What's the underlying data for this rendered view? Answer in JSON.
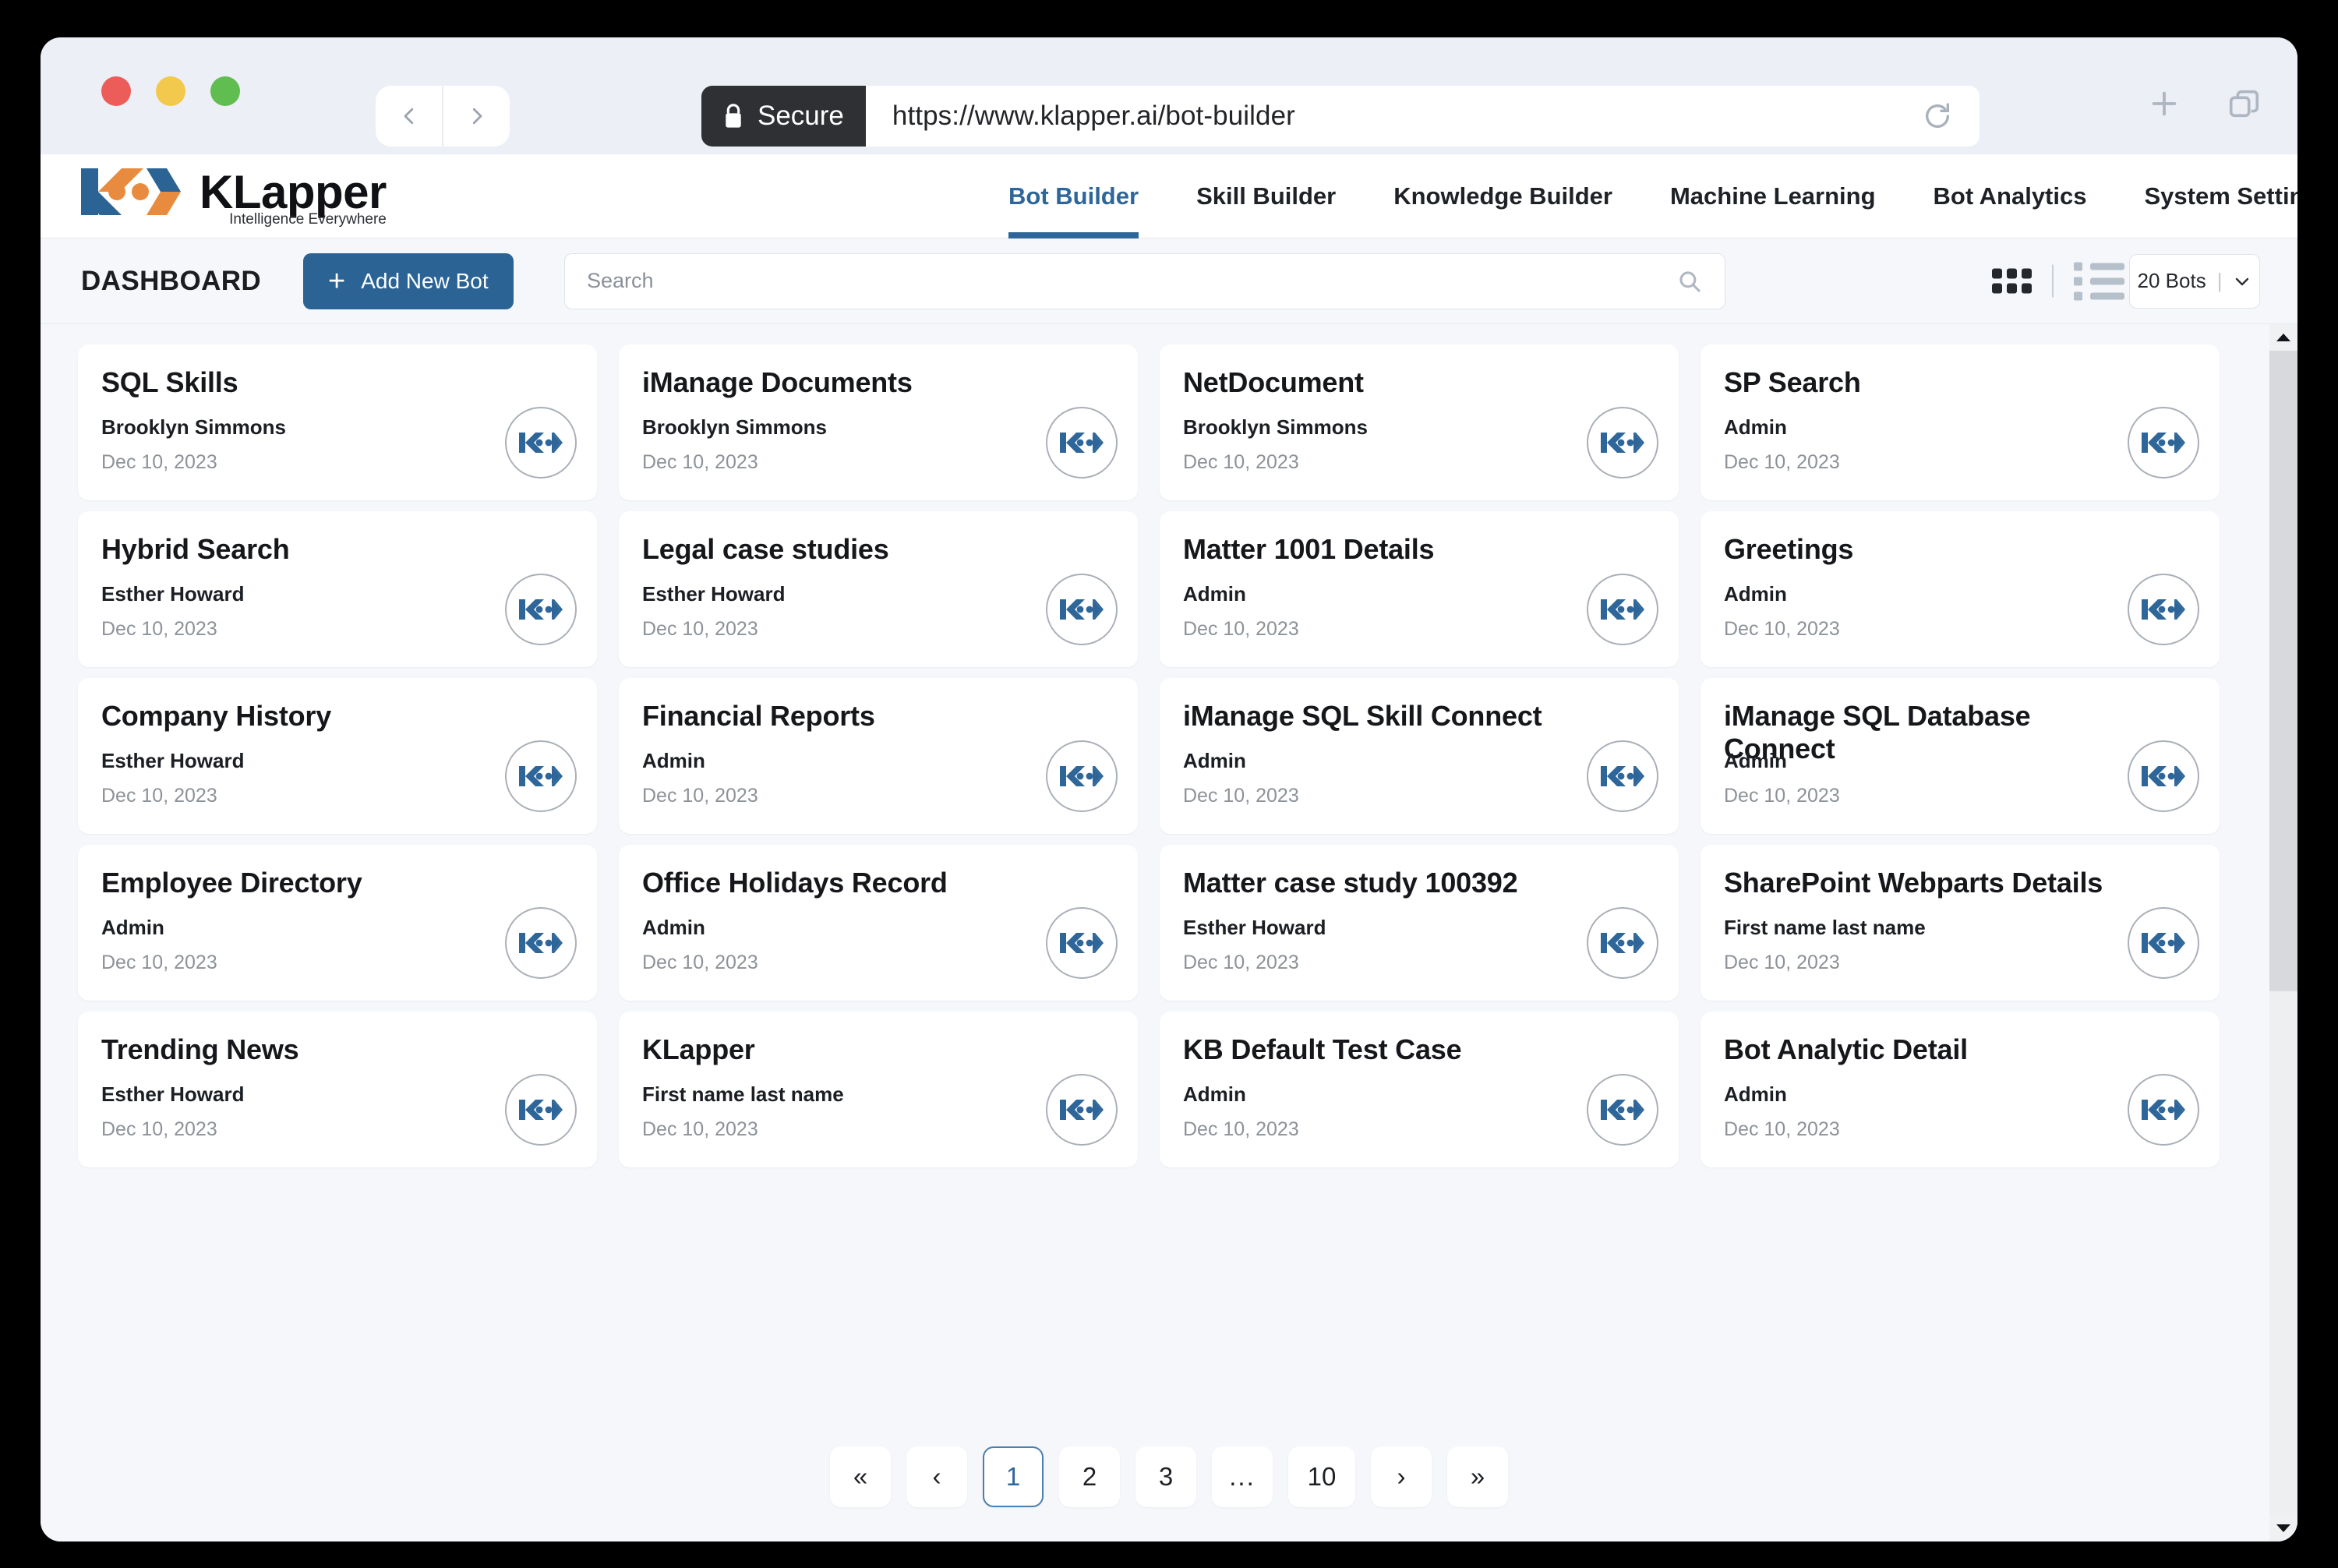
{
  "browser": {
    "back_icon": "chevron-left-icon",
    "forward_icon": "chevron-right-icon",
    "secure_label": "Secure",
    "url": "https://www.klapper.ai/bot-builder",
    "reload_icon": "reload-icon",
    "new_tab_icon": "plus-icon",
    "tabs_icon": "copy-tabs-icon"
  },
  "header": {
    "logo_word": "KLapper",
    "logo_tagline": "Intelligence Everywhere",
    "nav": [
      {
        "label": "Bot Builder",
        "active": true
      },
      {
        "label": "Skill Builder",
        "active": false
      },
      {
        "label": "Knowledge Builder",
        "active": false
      },
      {
        "label": "Machine Learning",
        "active": false
      },
      {
        "label": "Bot Analytics",
        "active": false
      },
      {
        "label": "System Settings",
        "active": false
      }
    ]
  },
  "toolbar": {
    "dashboard_label": "DASHBOARD",
    "add_bot_label": "Add New Bot",
    "add_bot_icon": "plus-icon",
    "search_placeholder": "Search",
    "search_value": "",
    "search_icon": "search-icon",
    "grid_view_icon": "grid-view-icon",
    "list_view_icon": "list-view-icon",
    "bots_count_label": "20 Bots",
    "bots_dropdown_icon": "chevron-down-icon"
  },
  "cards": [
    {
      "title": "SQL Skills",
      "owner": "Brooklyn Simmons",
      "date": "Dec 10, 2023"
    },
    {
      "title": "iManage Documents",
      "owner": "Brooklyn Simmons",
      "date": "Dec 10, 2023"
    },
    {
      "title": "NetDocument",
      "owner": "Brooklyn Simmons",
      "date": "Dec 10, 2023"
    },
    {
      "title": "SP Search",
      "owner": "Admin",
      "date": "Dec 10, 2023"
    },
    {
      "title": "Hybrid Search",
      "owner": "Esther Howard",
      "date": "Dec 10, 2023"
    },
    {
      "title": "Legal case studies",
      "owner": "Esther Howard",
      "date": "Dec 10, 2023"
    },
    {
      "title": "Matter 1001 Details",
      "owner": "Admin",
      "date": "Dec 10, 2023"
    },
    {
      "title": "Greetings",
      "owner": "Admin",
      "date": "Dec 10, 2023"
    },
    {
      "title": "Company History",
      "owner": "Esther Howard",
      "date": "Dec 10, 2023"
    },
    {
      "title": "Financial Reports",
      "owner": "Admin",
      "date": "Dec 10, 2023"
    },
    {
      "title": "iManage SQL Skill Connect",
      "owner": "Admin",
      "date": "Dec 10, 2023"
    },
    {
      "title": "iManage SQL Database Connect",
      "owner": "Admin",
      "date": "Dec 10, 2023"
    },
    {
      "title": "Employee Directory",
      "owner": "Admin",
      "date": "Dec 10, 2023"
    },
    {
      "title": "Office Holidays Record",
      "owner": "Admin",
      "date": "Dec 10, 2023"
    },
    {
      "title": "Matter case study 100392",
      "owner": "Esther Howard",
      "date": "Dec 10, 2023"
    },
    {
      "title": "SharePoint Webparts Details",
      "owner": "First name last name",
      "date": "Dec 10, 2023"
    },
    {
      "title": "Trending News",
      "owner": "Esther Howard",
      "date": "Dec 10, 2023"
    },
    {
      "title": "KLapper",
      "owner": "First name last name",
      "date": "Dec 10, 2023"
    },
    {
      "title": "KB Default Test Case",
      "owner": "Admin",
      "date": "Dec 10, 2023"
    },
    {
      "title": "Bot Analytic Detail",
      "owner": "Admin",
      "date": "Dec 10, 2023"
    }
  ],
  "pagination": {
    "first_label": "«",
    "prev_label": "‹",
    "pages": [
      "1",
      "2",
      "3",
      "...",
      "10"
    ],
    "current_page": "1",
    "next_label": "›",
    "last_label": "»"
  },
  "colors": {
    "brand_blue": "#2e6699",
    "brand_orange": "#e98b3e",
    "button_blue": "#2b6394",
    "page_bg": "#f5f7fa"
  }
}
